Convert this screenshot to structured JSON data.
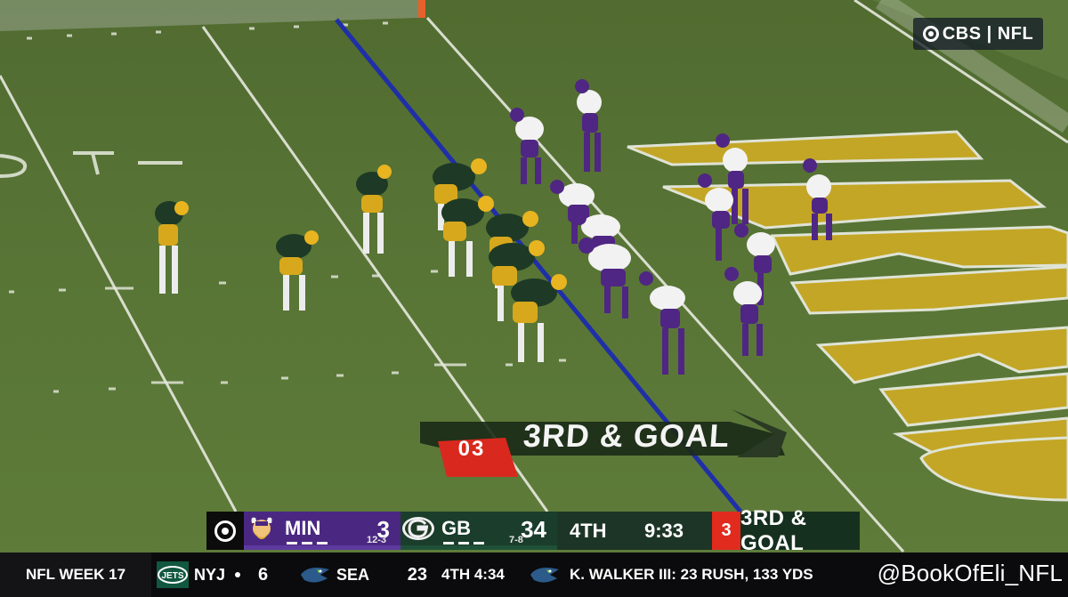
{
  "network_bug": {
    "text": "CBS | NFL"
  },
  "down_graphic": {
    "yard_number": "03",
    "text": "3RD & GOAL"
  },
  "scorebug": {
    "away": {
      "abbr": "MIN",
      "score": "3",
      "record": "12-3",
      "color": "#4a2882",
      "logo": "viking-icon"
    },
    "home": {
      "abbr": "GB",
      "score": "34",
      "record": "7-8",
      "color": "#1a3d2c",
      "logo": "packers-g-icon"
    },
    "quarter": "4TH",
    "clock": "9:33",
    "down_number": "3",
    "down_text": "3RD & GOAL"
  },
  "ticker": {
    "week": "NFL WEEK 17",
    "away_abbr": "NYJ",
    "away_score": "6",
    "home_abbr": "SEA",
    "home_score": "23",
    "game_clock": "4TH 4:34",
    "stat_line": "K. WALKER III: 23 RUSH, 133 YDS",
    "handle": "@BookOfEli_NFL",
    "away_logo": "jets-icon",
    "home_logo": "seahawks-icon"
  },
  "colors": {
    "field": "#587536",
    "scrimmage_line": "#1f2fa8",
    "endzone_paint": "#c9a925",
    "down_marker_red": "#e02b1e",
    "packers_green": "#1e3a26",
    "packers_gold": "#e8b420",
    "vikings_purple": "#4f2683"
  }
}
